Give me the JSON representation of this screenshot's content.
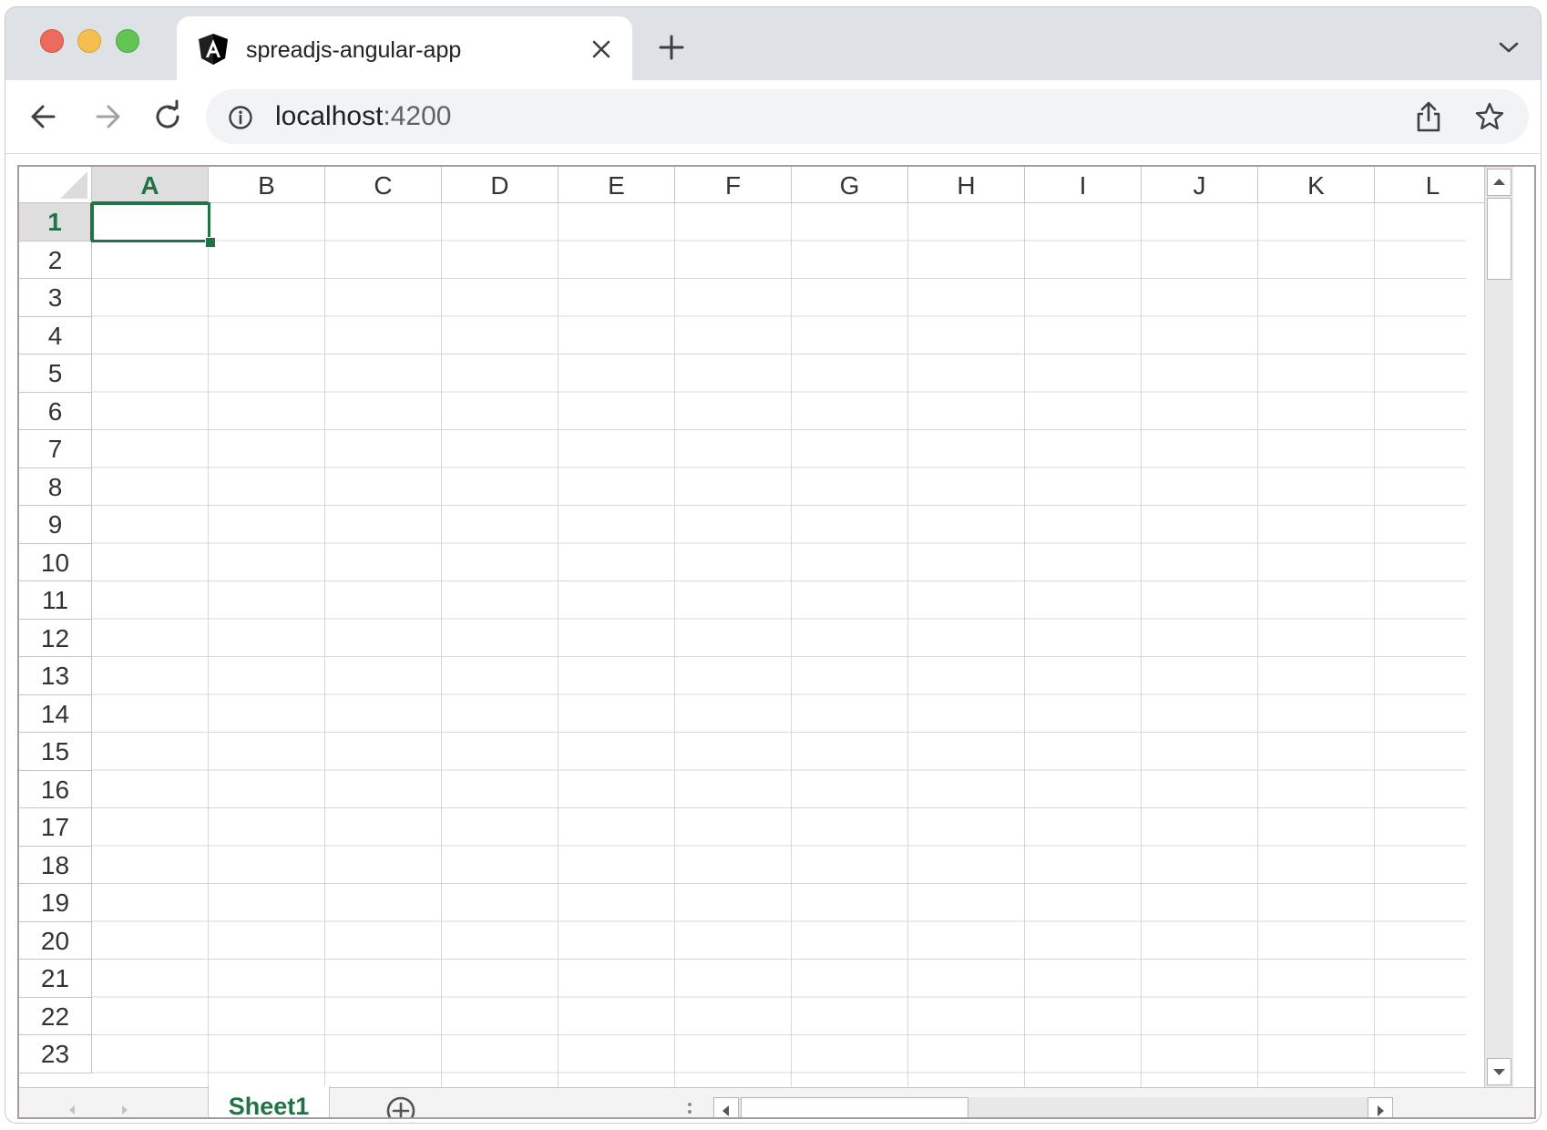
{
  "browser": {
    "tab": {
      "title": "spreadjs-angular-app",
      "favicon": "angular-icon"
    },
    "url": {
      "host": "localhost",
      "port": ":4200"
    },
    "colors": {
      "tabstrip_bg": "#dee1e6",
      "omnibox_bg": "#f1f3f4"
    }
  },
  "spreadsheet": {
    "columns": [
      "A",
      "B",
      "C",
      "D",
      "E",
      "F",
      "G",
      "H",
      "I",
      "J",
      "K",
      "L"
    ],
    "rows": [
      "1",
      "2",
      "3",
      "4",
      "5",
      "6",
      "7",
      "8",
      "9",
      "10",
      "11",
      "12",
      "13",
      "14",
      "15",
      "16",
      "17",
      "18",
      "19",
      "20",
      "21",
      "22",
      "23"
    ],
    "active_cell": {
      "column": "A",
      "row": "1"
    },
    "accent_color": "#217346",
    "sheet_tabs": [
      "Sheet1"
    ],
    "active_sheet": "Sheet1",
    "vertical_scroll_position": 0.0,
    "horizontal_scroll_position": 0.0
  }
}
